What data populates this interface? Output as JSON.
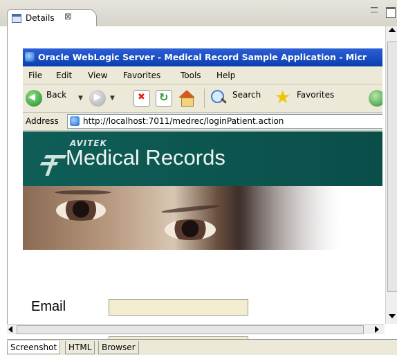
{
  "view": {
    "tab_title": "Details",
    "close_glyph": "⊠"
  },
  "browser": {
    "window_title": "Oracle WebLogic Server - Medical Record Sample Application - Micr",
    "menu": [
      "File",
      "Edit",
      "View",
      "Favorites",
      "Tools",
      "Help"
    ],
    "toolbar": {
      "back_label": "Back",
      "search_label": "Search",
      "favorites_label": "Favorites"
    },
    "address_label": "Address",
    "url": "http://localhost:7011/medrec/loginPatient.action"
  },
  "page": {
    "brand_small": "AVITEK",
    "brand_title": "Medical Records",
    "email_label": "Email",
    "email_value": ""
  },
  "bottom_tabs": [
    "Screenshot",
    "HTML",
    "Browser"
  ],
  "colors": {
    "banner": "#0f5e57",
    "input_bg": "#f2ecd0",
    "ie_title": "#2c5fd6"
  }
}
